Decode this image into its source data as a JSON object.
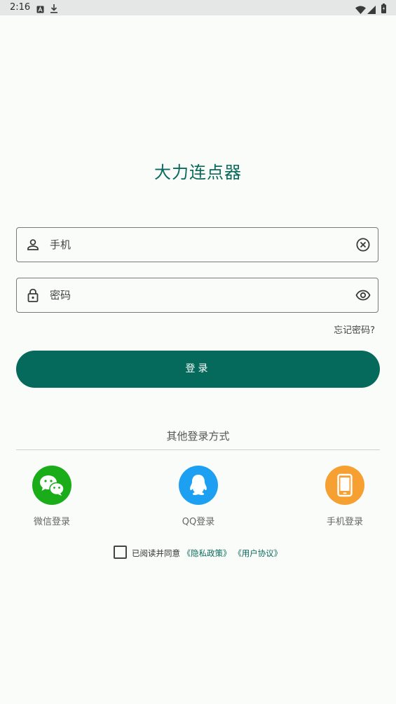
{
  "status_bar": {
    "time": "2:16"
  },
  "app": {
    "title": "大力连点器"
  },
  "phone_field": {
    "placeholder": "手机",
    "leading_icon": "person-icon",
    "trailing_icon": "clear-icon"
  },
  "password_field": {
    "placeholder": "密码",
    "leading_icon": "lock-icon",
    "trailing_icon": "eye-icon"
  },
  "forgot_password": "忘记密码?",
  "login_button": "登录",
  "other_login": {
    "label": "其他登录方式",
    "options": [
      {
        "label": "微信登录",
        "icon": "wechat-icon",
        "color": "#1aad19"
      },
      {
        "label": "QQ登录",
        "icon": "qq-icon",
        "color": "#1ea0f2"
      },
      {
        "label": "手机登录",
        "icon": "mobile-phone-icon",
        "color": "#f5a030"
      }
    ]
  },
  "agreement": {
    "prefix": "已阅读并同意",
    "privacy_link": "《隐私政策》",
    "terms_link": "《用户协议》"
  },
  "colors": {
    "accent": "#056a5b",
    "title": "#0b6a5b"
  }
}
